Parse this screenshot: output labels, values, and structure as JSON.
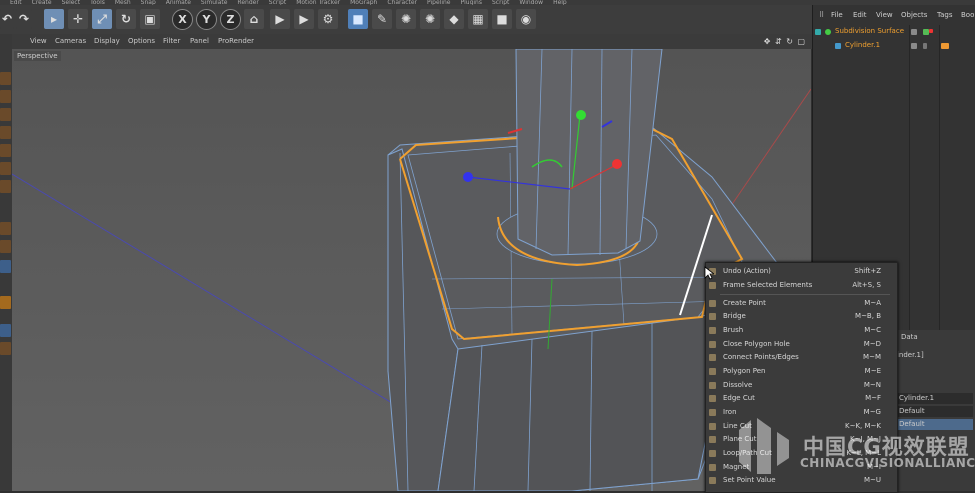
{
  "menubar": {
    "items": [
      "Edit",
      "Create",
      "Select",
      "Tools",
      "Mesh",
      "Snap",
      "Animate",
      "Simulate",
      "Render",
      "Script",
      "Motion Tracker",
      "MoGraph",
      "Character",
      "Pipeline",
      "Plugins",
      "Script",
      "Window",
      "Help"
    ]
  },
  "toolbar": {
    "undo_icon": "undo-icon",
    "axis_x": "X",
    "axis_y": "Y",
    "axis_z": "Z"
  },
  "viewport": {
    "menu": [
      "View",
      "Cameras",
      "Display",
      "Options",
      "Filter",
      "Panel",
      "ProRender"
    ],
    "label": "Perspective"
  },
  "object_manager": {
    "menu": [
      "File",
      "Edit",
      "View",
      "Objects",
      "Tags",
      "Boo"
    ],
    "objects": [
      {
        "name": "Subdivision Surface"
      },
      {
        "name": "Cylinder.1"
      }
    ]
  },
  "attributes": {
    "tab": "Data",
    "name_value": "linder.1]",
    "rows": [
      "Cylinder.1",
      "Default",
      "Default"
    ]
  },
  "context_menu": {
    "groups": [
      [
        {
          "label": "Undo (Action)",
          "shortcut": "Shift+Z",
          "icon": "undo-icon"
        },
        {
          "label": "Frame Selected Elements",
          "shortcut": "Alt+S, S",
          "icon": "frame-icon"
        }
      ],
      [
        {
          "label": "Create Point",
          "shortcut": "M~A",
          "icon": "create-point-icon"
        },
        {
          "label": "Bridge",
          "shortcut": "M~B, B",
          "icon": "bridge-icon"
        },
        {
          "label": "Brush",
          "shortcut": "M~C",
          "icon": "brush-icon"
        },
        {
          "label": "Close Polygon Hole",
          "shortcut": "M~D",
          "icon": "close-hole-icon"
        },
        {
          "label": "Connect Points/Edges",
          "shortcut": "M~M",
          "icon": "connect-icon"
        },
        {
          "label": "Polygon Pen",
          "shortcut": "M~E",
          "icon": "polygon-pen-icon"
        },
        {
          "label": "Dissolve",
          "shortcut": "M~N",
          "icon": "dissolve-icon"
        },
        {
          "label": "Edge Cut",
          "shortcut": "M~F",
          "icon": "edge-cut-icon"
        },
        {
          "label": "Iron",
          "shortcut": "M~G",
          "icon": "iron-icon"
        },
        {
          "label": "Line Cut",
          "shortcut": "K~K, M~K",
          "icon": "line-cut-icon"
        },
        {
          "label": "Plane Cut",
          "shortcut": "K~J, M~J",
          "icon": "plane-cut-icon"
        },
        {
          "label": "Loop/Path Cut",
          "shortcut": "K~L, M~L",
          "icon": "loop-cut-icon"
        },
        {
          "label": "Magnet",
          "shortcut": "M~I",
          "icon": "magnet-icon"
        },
        {
          "label": "Set Point Value",
          "shortcut": "M~U",
          "icon": "set-point-icon"
        }
      ]
    ]
  },
  "watermark": {
    "cn": "中国CG视效联盟",
    "en": "CHINACGVISIONALLIANCE"
  },
  "colors": {
    "selection": "#f0a030",
    "wire": "#7fa2cf",
    "mesh": "#5e5f62",
    "accent_toolbar": "#6f8fb5"
  }
}
